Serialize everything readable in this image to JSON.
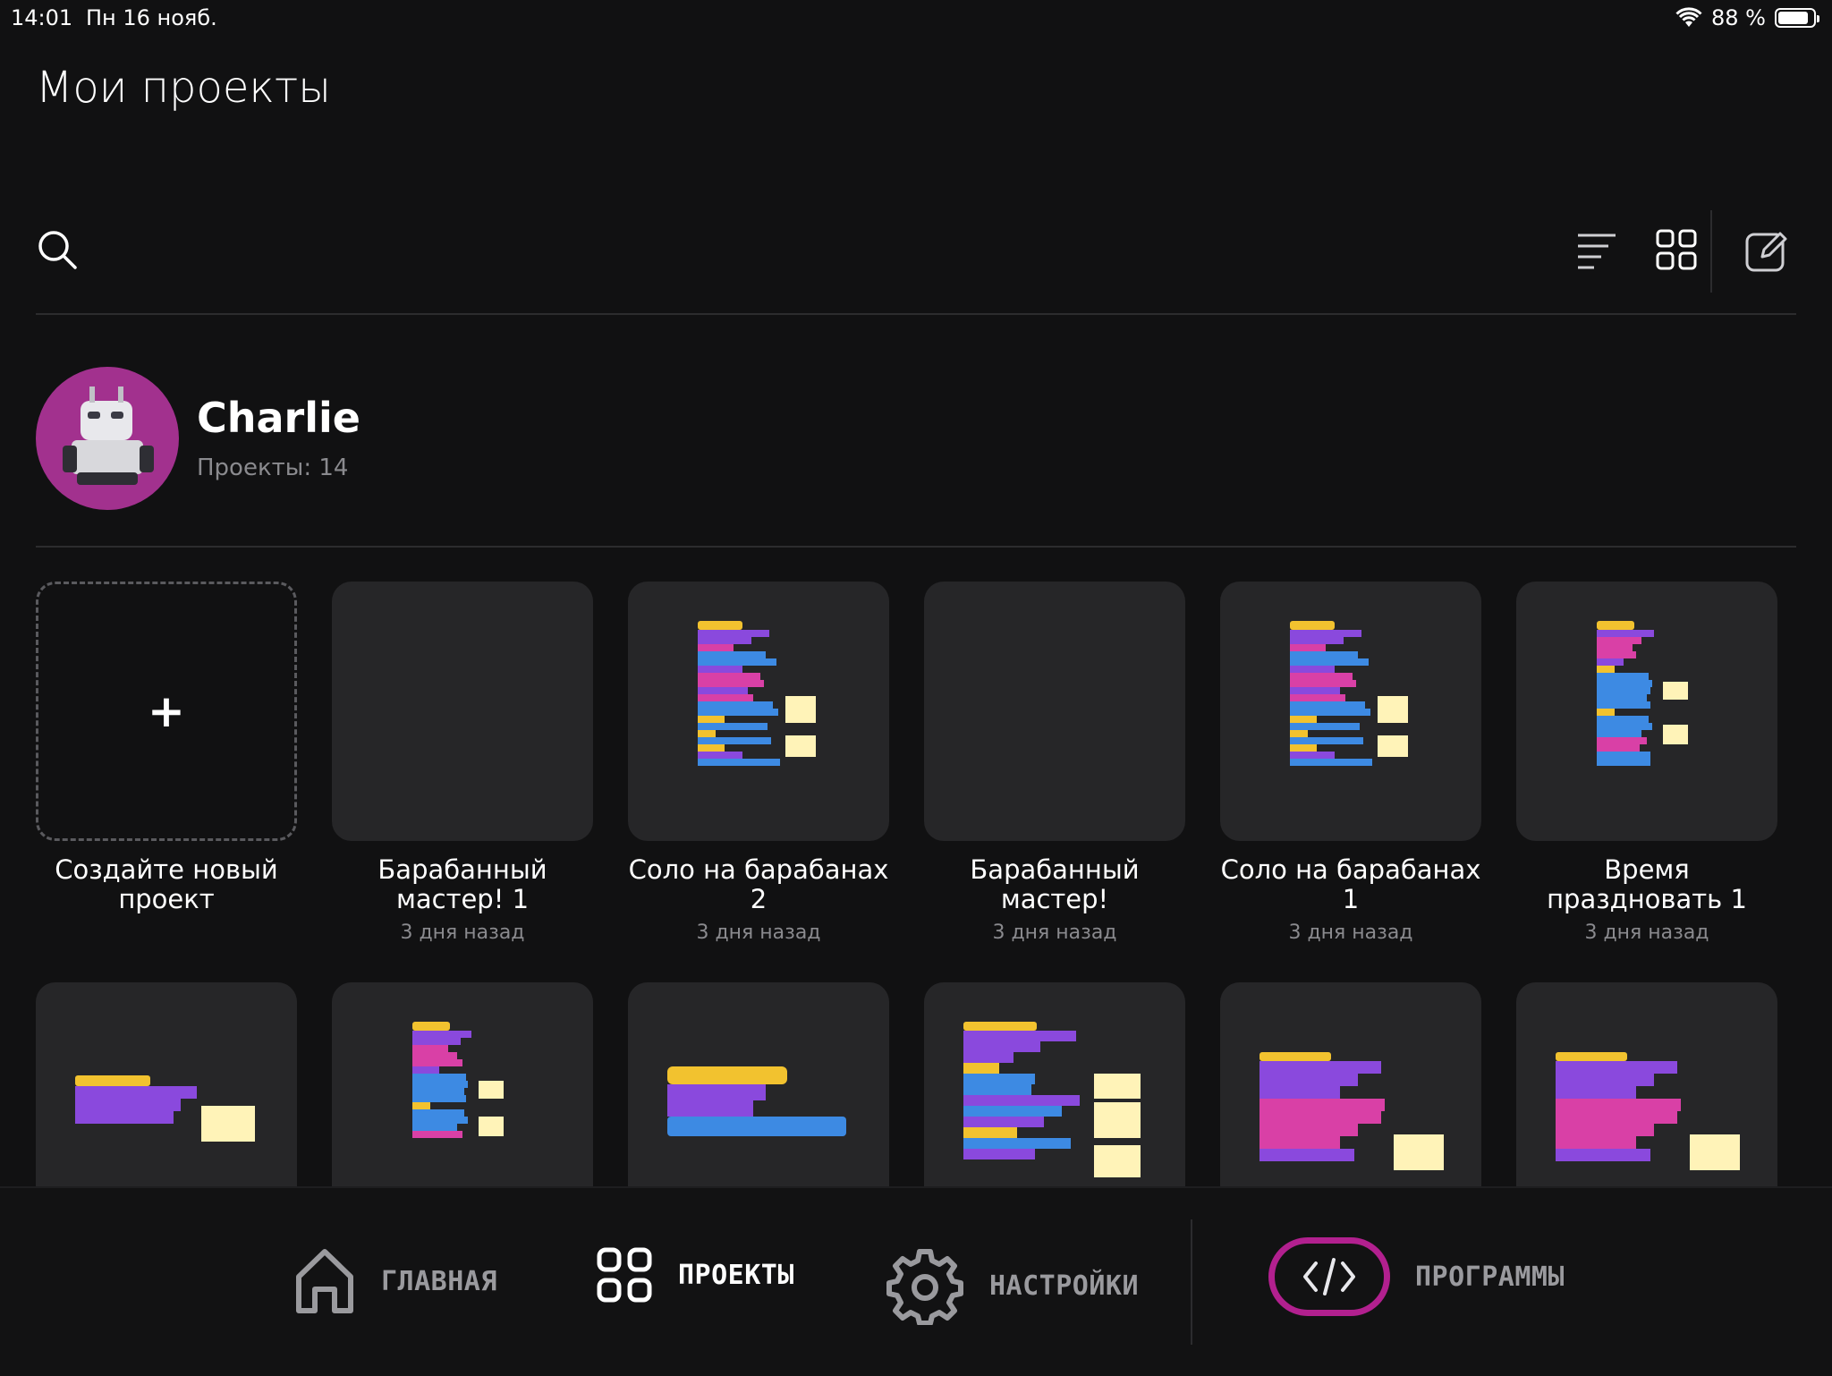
{
  "status_bar": {
    "time": "14:01",
    "date": "Пн 16 нояб.",
    "battery": "88 %",
    "battery_level": 0.88
  },
  "page": {
    "title": "Мои проекты"
  },
  "profile": {
    "name": "Charlie",
    "projects_label": "Проекты: 14"
  },
  "projects": [
    {
      "title": "Создайте новый проект",
      "date": "",
      "thumbnail": "plus-icon"
    },
    {
      "title": "Барабанный мастер! 1",
      "date": "3 дня назад",
      "thumbnail": "empty"
    },
    {
      "title": "Соло на барабанах 2",
      "date": "3 дня назад",
      "thumbnail": "code-blocks"
    },
    {
      "title": "Барабанный мастер!",
      "date": "3 дня назад",
      "thumbnail": "empty"
    },
    {
      "title": "Соло на барабанах 1",
      "date": "3 дня назад",
      "thumbnail": "code-blocks"
    },
    {
      "title": "Время праздновать 1",
      "date": "3 дня назад",
      "thumbnail": "code-blocks"
    }
  ],
  "tabs": [
    {
      "label": "ГЛАВНАЯ",
      "icon": "home-icon"
    },
    {
      "label": "ПРОЕКТЫ",
      "icon": "grid-icon",
      "active": true
    },
    {
      "label": "НАСТРОЙКИ",
      "icon": "gear-icon"
    },
    {
      "label": "ПРОГРАММЫ",
      "icon": "code-icon"
    }
  ],
  "colors": {
    "accent": "#b2208f",
    "avatar_bg": "#a2318e",
    "card_bg": "#262628",
    "background": "#111112"
  }
}
